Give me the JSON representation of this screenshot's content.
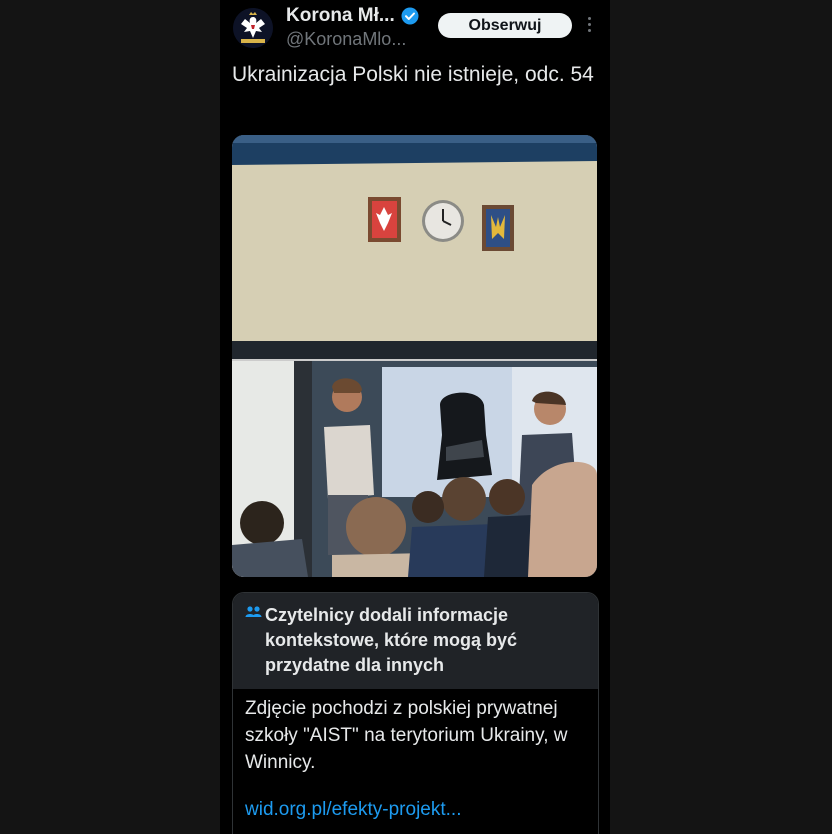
{
  "author": {
    "display_name": "Korona Mł...",
    "handle": "@KoronaMlo...",
    "verified": true,
    "avatar_icon": "crowned-eagle-logo"
  },
  "header": {
    "follow_label": "Obserwuj",
    "more_icon": "more-vertical-icon"
  },
  "tweet": {
    "text": "Ukrainizacja Polski nie istnieje, odc. 54"
  },
  "community_note": {
    "icon": "people-icon",
    "title": "Czytelnicy dodali informacje kontekstowe, które mogą być przydatne dla innych",
    "body": "Zdjęcie pochodzi z polskiej prywatnej szkoły \"AIST\" na terytorium Ukrainy, w Winnicy.",
    "link": "wid.org.pl/efekty-projekt..."
  },
  "colors": {
    "background": "#000000",
    "text": "#e7e9ea",
    "secondary_text": "#71767b",
    "link": "#1d9bf0",
    "verified": "#1d9bf0",
    "note_header": "#202327"
  }
}
